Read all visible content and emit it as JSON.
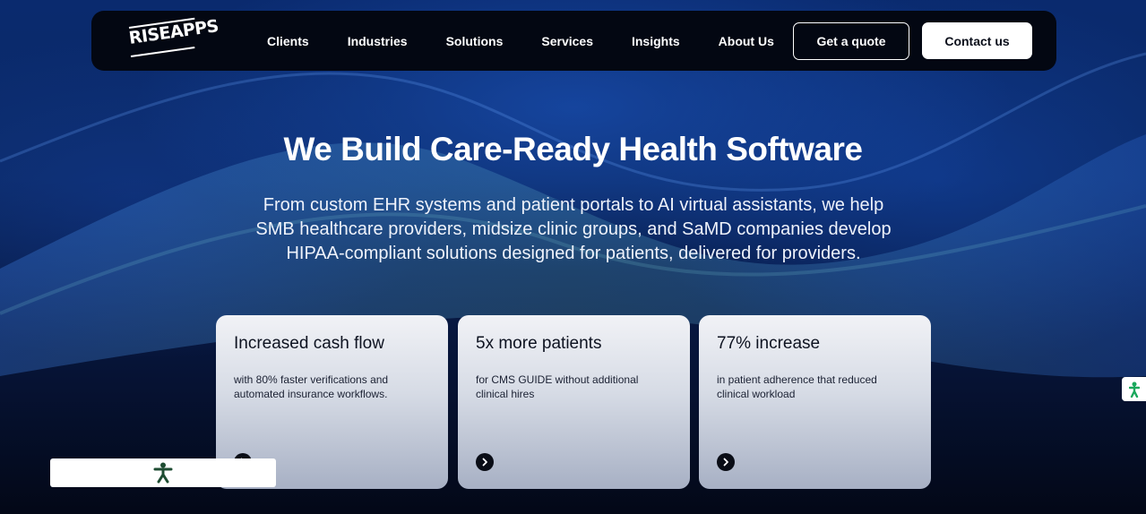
{
  "brand": {
    "logo_text": "RISEAPPS"
  },
  "nav": {
    "links": [
      "Clients",
      "Industries",
      "Solutions",
      "Services",
      "Insights",
      "About Us"
    ],
    "quote_label": "Get a quote",
    "contact_label": "Contact us"
  },
  "hero": {
    "title": "We Build Care-Ready Health Software",
    "subtitle_lines": [
      "From custom EHR systems and patient portals to AI virtual assistants, we help",
      "SMB healthcare providers, midsize clinic groups, and SaMD companies develop",
      "HIPAA-compliant solutions designed for patients, delivered for providers."
    ]
  },
  "cards": [
    {
      "title": "Increased cash flow",
      "description": "with 80% faster verifications and automated insurance workflows.",
      "arrow_icon": "chevron-right-icon"
    },
    {
      "title": "5x more patients",
      "description": "for CMS GUIDE without additional clinical hires",
      "arrow_icon": "chevron-right-icon"
    },
    {
      "title": "77% increase",
      "description": "in patient adherence that reduced clinical workload",
      "arrow_icon": "chevron-right-icon"
    }
  ],
  "widgets": {
    "accessibility_icon": "accessibility-person-icon",
    "side_tab_icon": "accessibility-person-icon",
    "accessibility_color": "#1f4d33",
    "side_tab_color": "#1aa85c"
  },
  "colors": {
    "background": "#040b1f",
    "nav_background": "#030712",
    "card_top": "#f1f2f6",
    "card_bottom": "#a7b0c4"
  }
}
